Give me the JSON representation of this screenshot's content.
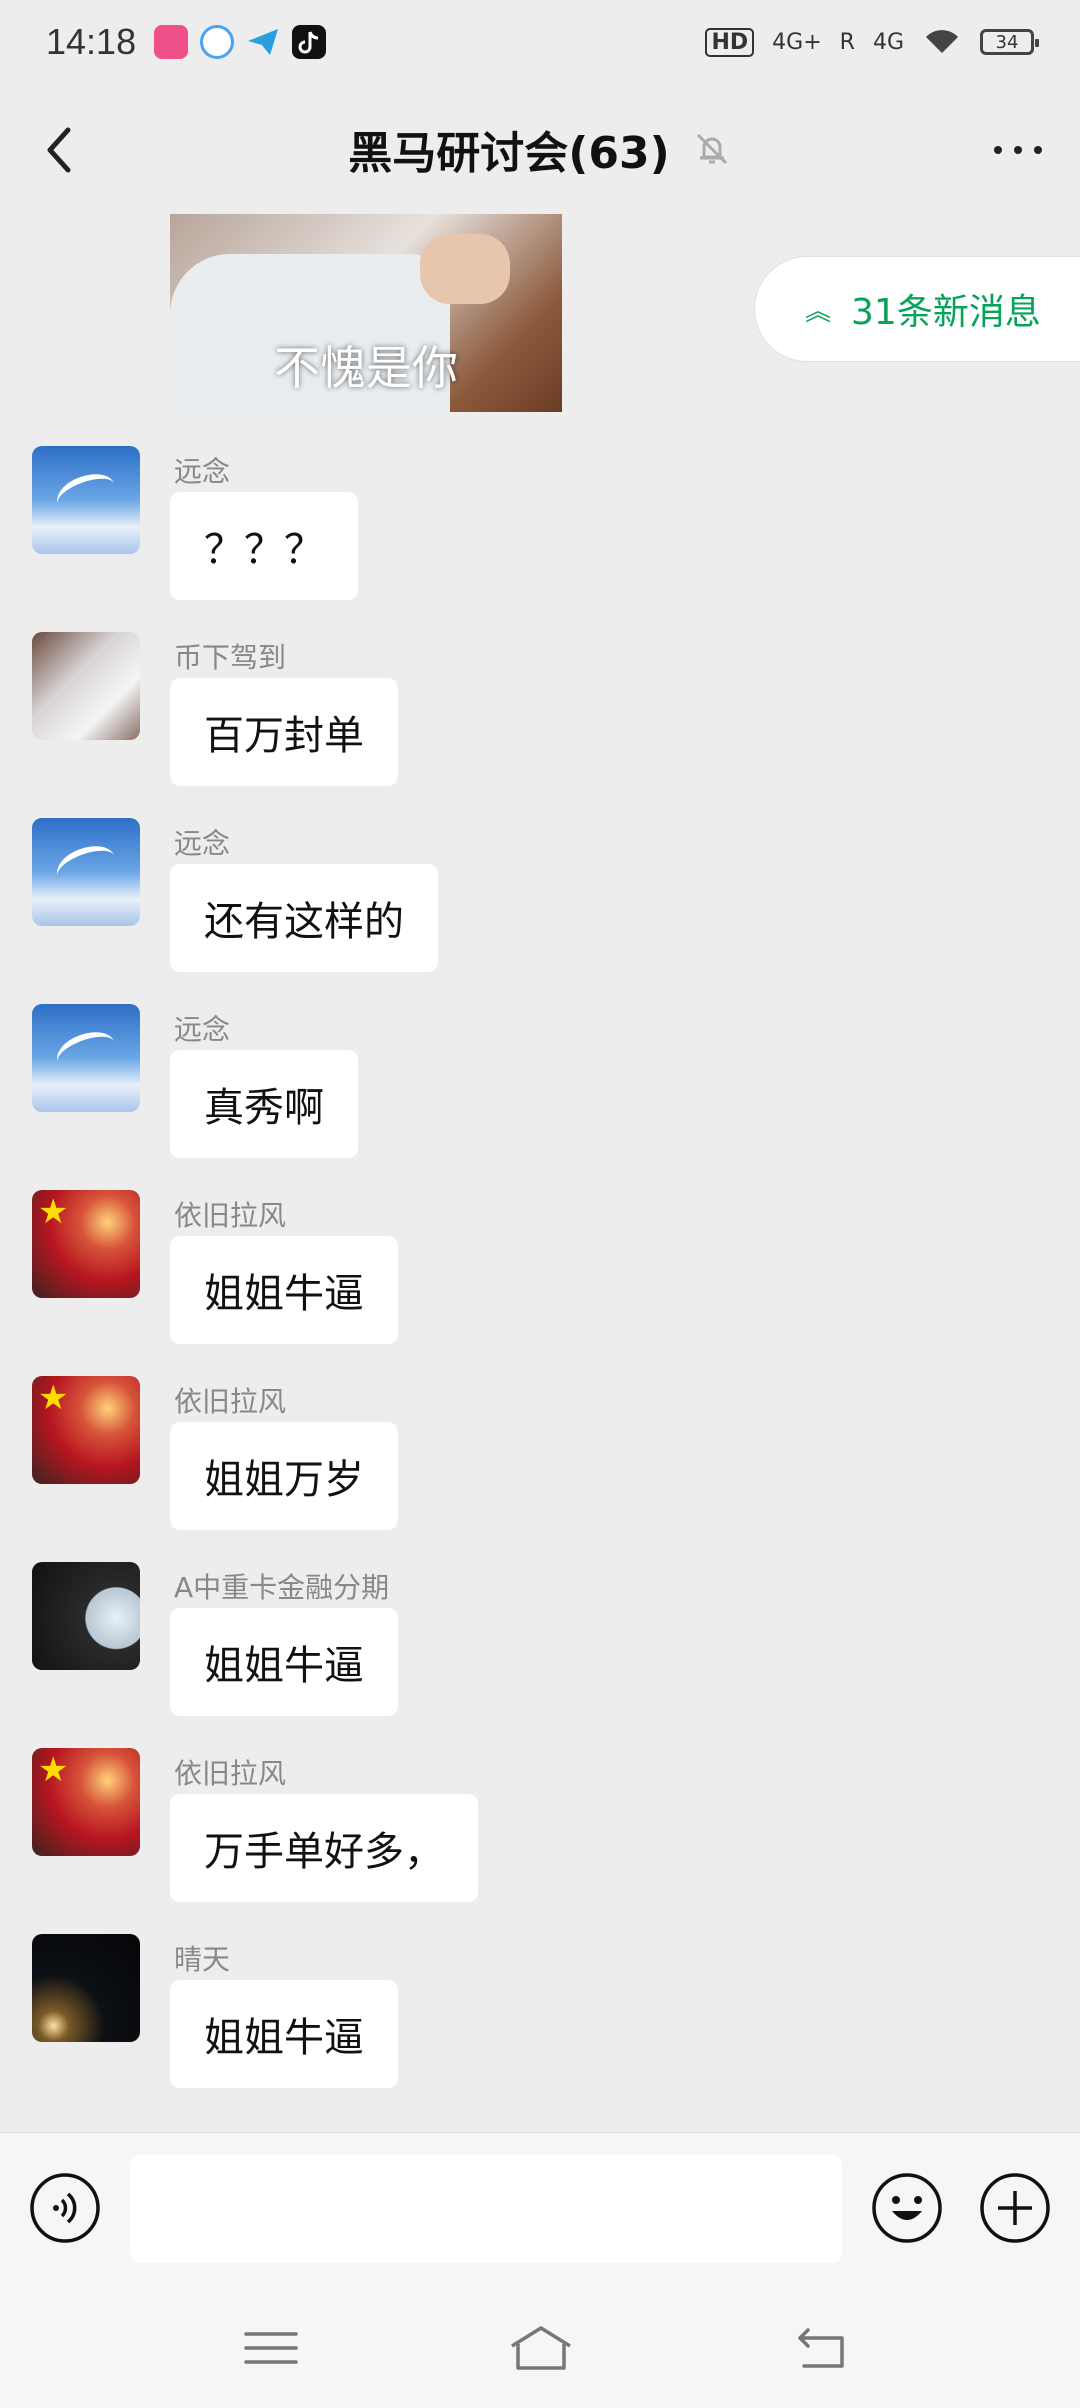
{
  "status_bar": {
    "time": "14:18",
    "signal_text_1": "4G+",
    "signal_text_2": "4G",
    "roaming": "R",
    "hd": "HD",
    "battery": "34",
    "app_icons": [
      "soul-app-icon",
      "baidu-cloud-icon",
      "telegram-icon",
      "tiktok-icon"
    ]
  },
  "header": {
    "title": "黑马研讨会(63)",
    "icons": [
      "back-arrow-icon",
      "bell-muted-icon",
      "more-dots-icon"
    ]
  },
  "sticker": {
    "caption": "不愧是你"
  },
  "new_messages": {
    "label": "31条新消息",
    "color": "#07a35a"
  },
  "messages": [
    {
      "sender": "远念",
      "text": "？？？",
      "avatar": "seagull-avatar"
    },
    {
      "sender": "币下驾到",
      "text": "百万封单",
      "avatar": "girl-avatar"
    },
    {
      "sender": "远念",
      "text": "还有这样的",
      "avatar": "seagull-avatar"
    },
    {
      "sender": "远念",
      "text": "真秀啊",
      "avatar": "seagull-avatar"
    },
    {
      "sender": "依旧拉风",
      "text": "姐姐牛逼",
      "avatar": "flag-avatar"
    },
    {
      "sender": "依旧拉风",
      "text": "姐姐万岁",
      "avatar": "flag-avatar"
    },
    {
      "sender": "A中重卡金融分期",
      "text": "姐姐牛逼",
      "avatar": "moon-avatar"
    },
    {
      "sender": "依旧拉风",
      "text": "万手单好多，",
      "avatar": "flag-avatar"
    },
    {
      "sender": "晴天",
      "text": "姐姐牛逼",
      "avatar": "night-avatar"
    }
  ],
  "input_bar": {
    "value": "",
    "icons": [
      "voice-icon",
      "emoji-icon",
      "plus-icon"
    ]
  },
  "nav_bar": {
    "icons": [
      "menu-icon",
      "home-icon",
      "back-icon"
    ]
  },
  "colors": {
    "background": "#ededed",
    "bubble": "#ffffff",
    "accent": "#07a35a"
  }
}
